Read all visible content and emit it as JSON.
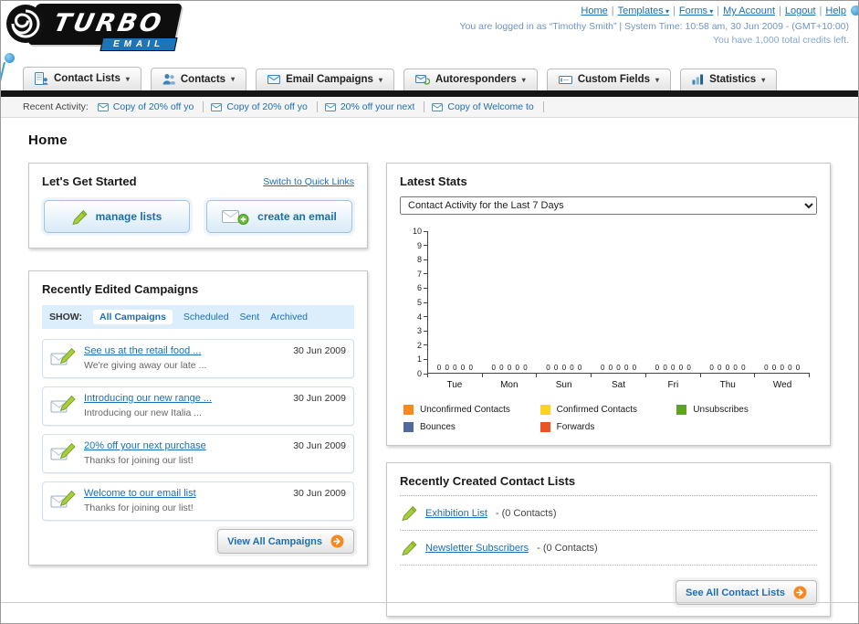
{
  "page_title": "Home",
  "header": {
    "logo_line1": "TURBO",
    "logo_line2": "EMAIL",
    "nav_links": [
      {
        "label": "Home",
        "dropdown": false
      },
      {
        "label": "Templates",
        "dropdown": true
      },
      {
        "label": "Forms",
        "dropdown": true
      },
      {
        "label": "My Account",
        "dropdown": false
      },
      {
        "label": "Logout",
        "dropdown": false
      },
      {
        "label": "Help",
        "dropdown": false
      }
    ],
    "login_info": "You are logged in as “Timothy Smith” | System Time: 10:58 am, 30 Jun 2009 - (GMT+10:00)",
    "credits_info": "You have 1,000 total credits left."
  },
  "nav_tabs": [
    {
      "label": "Contact Lists",
      "icon": "contact-lists-icon"
    },
    {
      "label": "Contacts",
      "icon": "contacts-icon"
    },
    {
      "label": "Email Campaigns",
      "icon": "email-campaigns-icon"
    },
    {
      "label": "Autoresponders",
      "icon": "autoresponders-icon"
    },
    {
      "label": "Custom Fields",
      "icon": "custom-fields-icon"
    },
    {
      "label": "Statistics",
      "icon": "statistics-icon"
    }
  ],
  "recent_activity": {
    "label": "Recent Activity:",
    "items": [
      {
        "label": "Copy of 20% off yo",
        "icon": "envelope-icon"
      },
      {
        "label": "Copy of 20% off yo",
        "icon": "envelope-icon"
      },
      {
        "label": "20% off your next",
        "icon": "envelope-icon"
      },
      {
        "label": "Copy of Welcome to",
        "icon": "envelope-icon"
      }
    ]
  },
  "get_started": {
    "title": "Let's Get Started",
    "switch_link": "Switch to Quick Links",
    "buttons": [
      {
        "label": "manage lists",
        "icon": "pencil-icon"
      },
      {
        "label": "create an email",
        "icon": "envelope-plus-icon"
      }
    ]
  },
  "campaigns": {
    "title": "Recently Edited Campaigns",
    "show_label": "SHOW:",
    "filters": [
      {
        "label": "All Campaigns",
        "selected": true
      },
      {
        "label": "Scheduled",
        "selected": false
      },
      {
        "label": "Sent",
        "selected": false
      },
      {
        "label": "Archived",
        "selected": false
      }
    ],
    "items": [
      {
        "title": "See us at the retail food ...",
        "subtitle": "We're giving away our late ...",
        "date": "30 Jun 2009"
      },
      {
        "title": "Introducing our new range ...",
        "subtitle": "Introducing our new Italia ...",
        "date": "30 Jun 2009"
      },
      {
        "title": "20% off your next purchase",
        "subtitle": "Thanks for joining our list!",
        "date": "30 Jun 2009"
      },
      {
        "title": "Welcome to our email list",
        "subtitle": "Thanks for joining our list!",
        "date": "30 Jun 2009"
      }
    ],
    "view_all_label": "View All Campaigns"
  },
  "stats": {
    "title": "Latest Stats",
    "dropdown_value": "Contact Activity for the Last 7 Days"
  },
  "chart_data": {
    "type": "bar",
    "title": "Contact Activity for the Last 7 Days",
    "categories": [
      "Tue",
      "Mon",
      "Sun",
      "Sat",
      "Fri",
      "Thu",
      "Wed"
    ],
    "series": [
      {
        "name": "Unconfirmed Contacts",
        "color": "#F6891F",
        "values": [
          0,
          0,
          0,
          0,
          0,
          0,
          0
        ]
      },
      {
        "name": "Confirmed Contacts",
        "color": "#FFD21E",
        "values": [
          0,
          0,
          0,
          0,
          0,
          0,
          0
        ]
      },
      {
        "name": "Unsubscribes",
        "color": "#5FA321",
        "values": [
          0,
          0,
          0,
          0,
          0,
          0,
          0
        ]
      },
      {
        "name": "Bounces",
        "color": "#51699C",
        "values": [
          0,
          0,
          0,
          0,
          0,
          0,
          0
        ]
      },
      {
        "name": "Forwards",
        "color": "#E85426",
        "values": [
          0,
          0,
          0,
          0,
          0,
          0,
          0
        ]
      }
    ],
    "ylim": [
      0,
      10
    ],
    "ytick_step": 1,
    "grid": false,
    "legend_position": "bottom",
    "value_labels_shown": true
  },
  "contact_lists": {
    "title": "Recently Created Contact Lists",
    "items": [
      {
        "name": "Exhibition List",
        "detail": "- (0 Contacts)",
        "icon": "pencil-icon"
      },
      {
        "name": "Newsletter Subscribers",
        "detail": "- (0 Contacts)",
        "icon": "pencil-icon"
      }
    ],
    "see_all_label": "See All Contact Lists"
  },
  "colors": {
    "link_blue": "#1B6FB5",
    "accent_orange": "#F6891F",
    "nav_bar_black": "#161616",
    "filter_bar_blue": "#DCEEFB"
  }
}
